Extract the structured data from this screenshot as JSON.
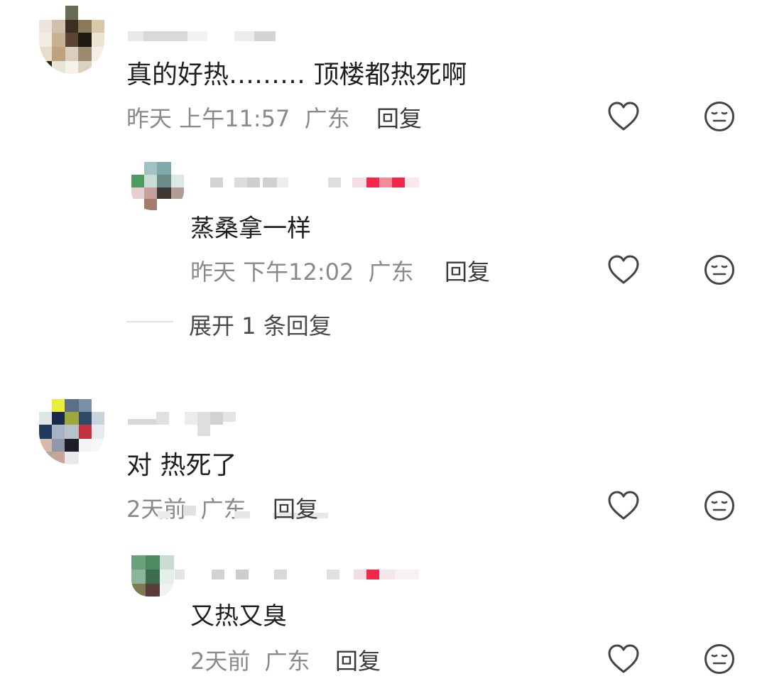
{
  "comments": [
    {
      "text": "真的好热……… 顶楼都热死啊",
      "time": "昨天 上午11:57",
      "location": "广东",
      "reply_label": "回复",
      "replies": [
        {
          "text": "蒸桑拿一样",
          "time": "昨天 下午12:02",
          "location": "广东",
          "reply_label": "回复"
        }
      ],
      "expand_label": "展开 1 条回复"
    },
    {
      "text": "对 热死了",
      "time": "2天前",
      "location": "广东",
      "reply_label": "回复",
      "replies": [
        {
          "text": "又热又臭",
          "time": "2天前",
          "location": "广东",
          "reply_label": "回复"
        }
      ]
    }
  ],
  "icons": {
    "like": "heart-outline-icon",
    "dislike": "neutral-face-icon"
  },
  "colors": {
    "text": "#1f1f1f",
    "meta": "#8a8a8a",
    "icon": "#444444",
    "badge": "#f0284a"
  }
}
